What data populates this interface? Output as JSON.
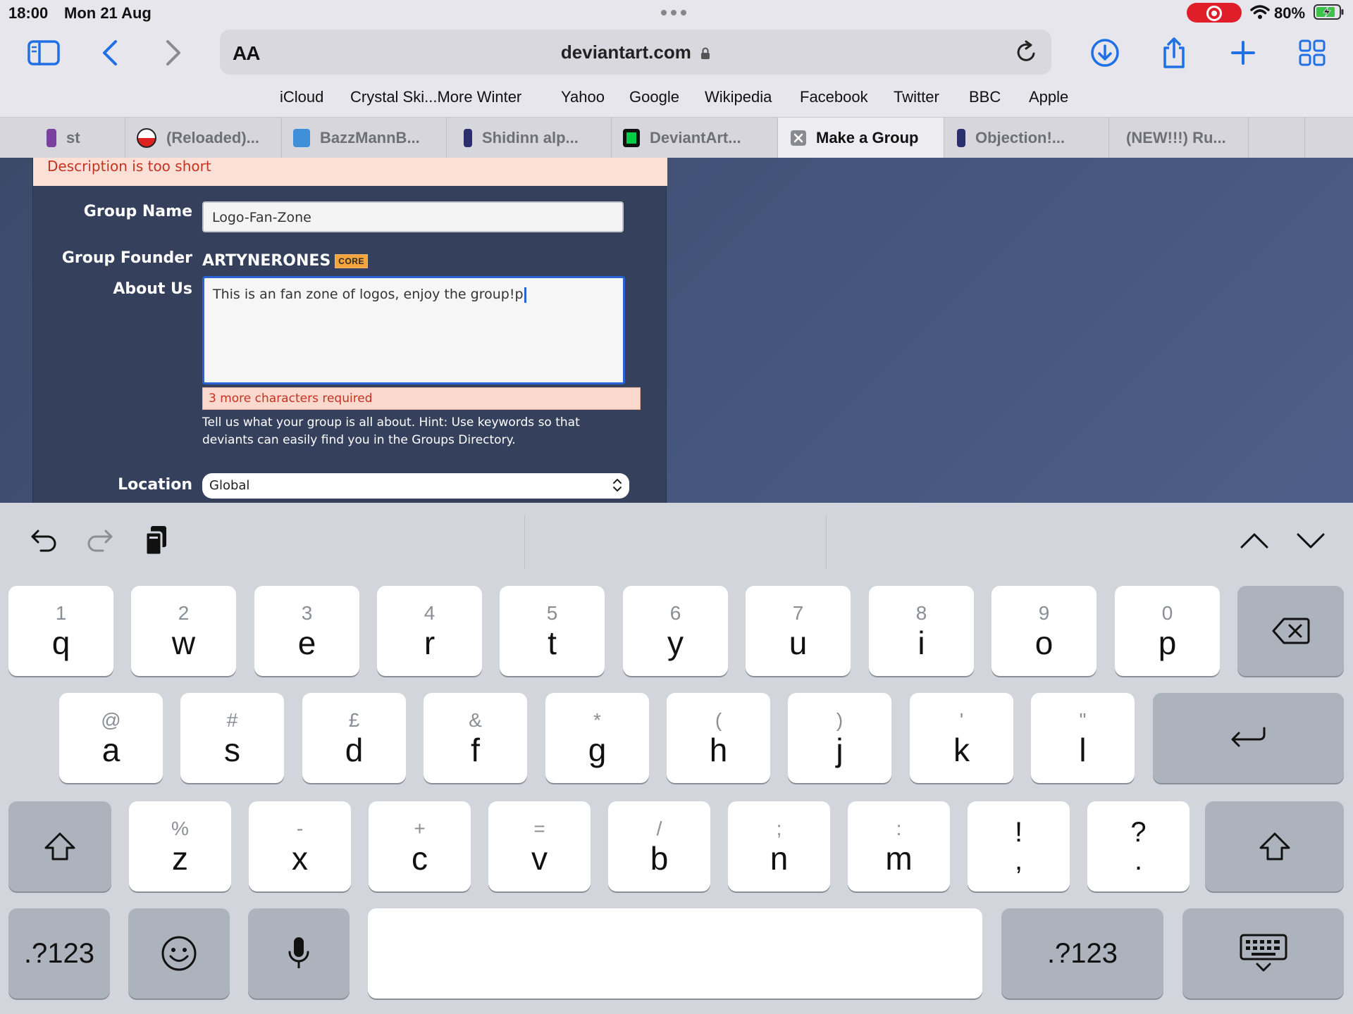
{
  "status_bar": {
    "time": "18:00",
    "date": "Mon 21 Aug",
    "battery": "80%"
  },
  "url_bar": {
    "aa_label": "AA",
    "domain": "deviantart.com"
  },
  "favorites": [
    "iCloud",
    "Crystal Ski...More Winter",
    "Yahoo",
    "Google",
    "Wikipedia",
    "Facebook",
    "Twitter",
    "BBC",
    "Apple"
  ],
  "tabs": [
    {
      "label": "st",
      "active": false
    },
    {
      "label": "(Reloaded)...",
      "active": false
    },
    {
      "label": "BazzMannB...",
      "active": false
    },
    {
      "label": "Shidinn alp...",
      "active": false
    },
    {
      "label": "DeviantArt...",
      "active": false
    },
    {
      "label": "Make a Group",
      "active": true
    },
    {
      "label": "Objection!...",
      "active": false
    },
    {
      "label": "(NEW!!!) Ru...",
      "active": false
    }
  ],
  "form": {
    "error_banner": "Description is too short",
    "group_name_label": "Group Name",
    "group_name_value": "Logo-Fan-Zone",
    "founder_label": "Group Founder",
    "founder_name": "ARTYNERONES",
    "founder_badge": "CORE",
    "about_label": "About Us",
    "about_value": "This is an fan zone of logos, enjoy the group!p",
    "chars_required": "3 more characters required",
    "hint": "Tell us what your group is all about. Hint: Use keywords so that deviants can easily find you in the Groups Directory.",
    "location_label": "Location",
    "location_value": "Global"
  },
  "keyboard": {
    "row1": [
      {
        "sub": "1",
        "main": "q"
      },
      {
        "sub": "2",
        "main": "w"
      },
      {
        "sub": "3",
        "main": "e"
      },
      {
        "sub": "4",
        "main": "r"
      },
      {
        "sub": "5",
        "main": "t"
      },
      {
        "sub": "6",
        "main": "y"
      },
      {
        "sub": "7",
        "main": "u"
      },
      {
        "sub": "8",
        "main": "i"
      },
      {
        "sub": "9",
        "main": "o"
      },
      {
        "sub": "0",
        "main": "p"
      }
    ],
    "row2": [
      {
        "sub": "@",
        "main": "a"
      },
      {
        "sub": "#",
        "main": "s"
      },
      {
        "sub": "£",
        "main": "d"
      },
      {
        "sub": "&",
        "main": "f"
      },
      {
        "sub": "*",
        "main": "g"
      },
      {
        "sub": "(",
        "main": "h"
      },
      {
        "sub": ")",
        "main": "j"
      },
      {
        "sub": "'",
        "main": "k"
      },
      {
        "sub": "\"",
        "main": "l"
      }
    ],
    "row3": [
      {
        "sub": "%",
        "main": "z"
      },
      {
        "sub": "-",
        "main": "x"
      },
      {
        "sub": "+",
        "main": "c"
      },
      {
        "sub": "=",
        "main": "v"
      },
      {
        "sub": "/",
        "main": "b"
      },
      {
        "sub": ";",
        "main": "n"
      },
      {
        "sub": ":",
        "main": "m"
      },
      {
        "sub": "!",
        "main": ","
      },
      {
        "sub": "?",
        "main": "."
      }
    ],
    "numbers_label": ".?123"
  }
}
